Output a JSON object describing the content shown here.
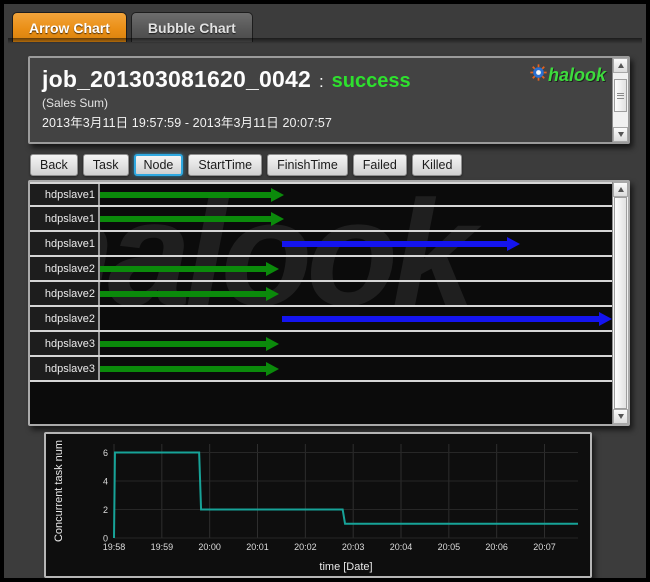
{
  "tabs": [
    {
      "label": "Arrow Chart",
      "active": true
    },
    {
      "label": "Bubble Chart",
      "active": false
    }
  ],
  "header": {
    "job_id": "job_201303081620_0042",
    "separator": ":",
    "status": "success",
    "status_color": "#2ee02e",
    "subtitle": "(Sales Sum)",
    "time_range": "2013年3月11日 19:57:59 - 2013年3月11日 20:07:57",
    "logo_text": "halook",
    "logo_icon": "gear-icon"
  },
  "toolbar": {
    "buttons": [
      {
        "label": "Back",
        "selected": false
      },
      {
        "label": "Task",
        "selected": false
      },
      {
        "label": "Node",
        "selected": true
      },
      {
        "label": "StartTime",
        "selected": false
      },
      {
        "label": "FinishTime",
        "selected": false
      },
      {
        "label": "Failed",
        "selected": false
      },
      {
        "label": "Killed",
        "selected": false
      }
    ],
    "selected_color": "#2fa8e0"
  },
  "arrow_chart": {
    "watermark": "halook",
    "colors": {
      "green": "#0b8a0b",
      "blue": "#1414ef"
    },
    "rows": [
      {
        "label": "hdpslave1",
        "color": "green",
        "start_pct": 0,
        "end_pct": 36
      },
      {
        "label": "hdpslave1",
        "color": "green",
        "start_pct": 0,
        "end_pct": 36
      },
      {
        "label": "hdpslave1",
        "color": "blue",
        "start_pct": 35.5,
        "end_pct": 82
      },
      {
        "label": "hdpslave2",
        "color": "green",
        "start_pct": 0,
        "end_pct": 35
      },
      {
        "label": "hdpslave2",
        "color": "green",
        "start_pct": 0,
        "end_pct": 35
      },
      {
        "label": "hdpslave2",
        "color": "blue",
        "start_pct": 35.5,
        "end_pct": 100
      },
      {
        "label": "hdpslave3",
        "color": "green",
        "start_pct": 0,
        "end_pct": 35
      },
      {
        "label": "hdpslave3",
        "color": "green",
        "start_pct": 0,
        "end_pct": 35
      }
    ]
  },
  "chart_data": {
    "type": "line",
    "title": "",
    "xlabel": "time [Date]",
    "ylabel": "Concurrent task num",
    "line_color": "#17a398",
    "grid": true,
    "legend": "none",
    "ylim": [
      0,
      6.6
    ],
    "yticks": [
      0,
      2,
      4,
      6
    ],
    "xticks": [
      "19:58",
      "19:59",
      "20:00",
      "20:01",
      "20:02",
      "20:03",
      "20:04",
      "20:05",
      "20:06",
      "20:07"
    ],
    "xlim_minutes": [
      0,
      9.7
    ],
    "step": "post",
    "x": [
      0,
      0.02,
      1.78,
      1.82,
      4.78,
      4.83,
      9.7
    ],
    "y": [
      0,
      6,
      6,
      2,
      2,
      1,
      1
    ]
  },
  "scrollbars": {
    "header": {
      "thumb_top_pct": 12,
      "thumb_height_pct": 60
    },
    "arrow": {
      "thumb_top_pct": 0,
      "thumb_height_pct": 100
    }
  }
}
